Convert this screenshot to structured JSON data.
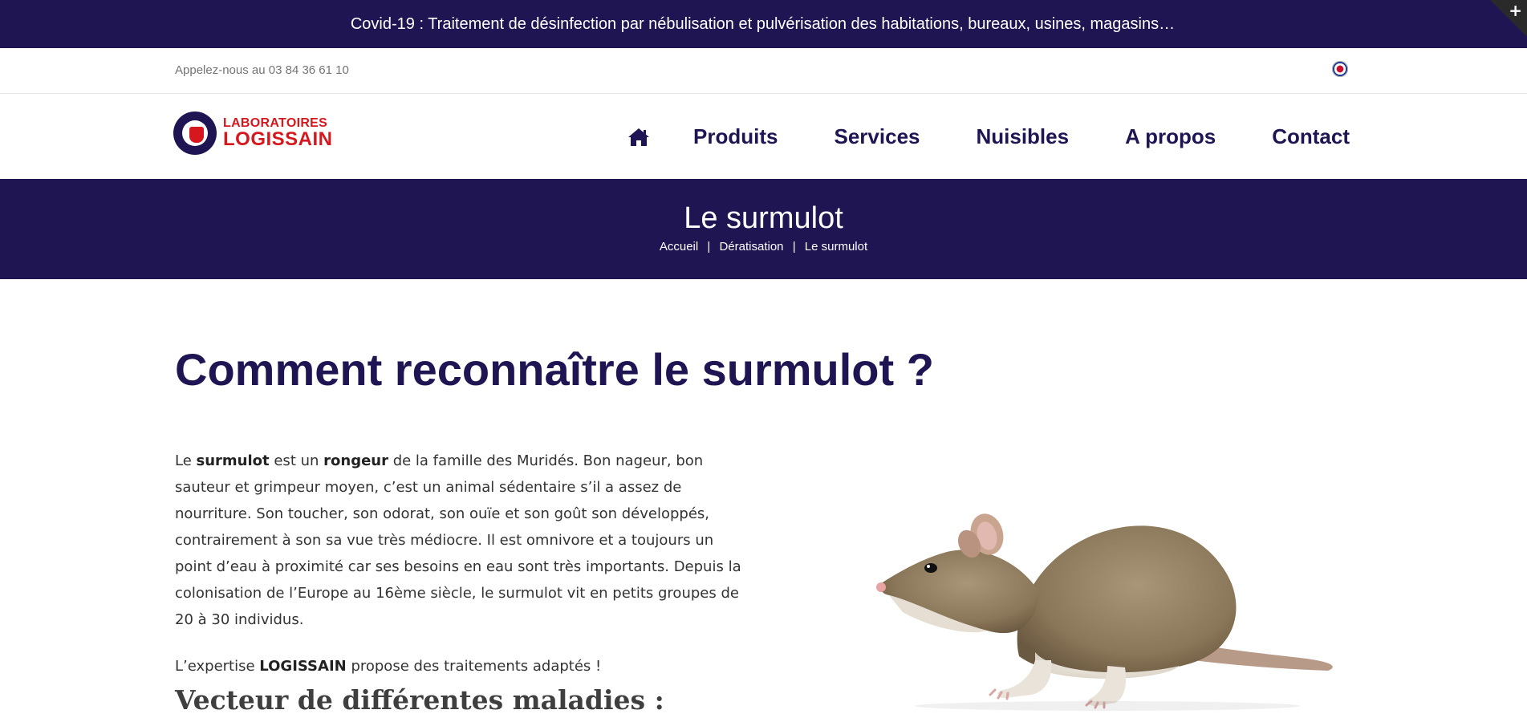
{
  "covid_banner": {
    "text": "Covid-19 : Traitement de désinfection par nébulisation et pulvérisation des habitations, bureaux, usines, magasins…"
  },
  "corner_toggle": {
    "symbol": "+"
  },
  "topbar": {
    "phone_text": "Appelez-nous au 03 84 36 61 10",
    "language_flag_icon": "flag-icon"
  },
  "logo": {
    "line1": "LABORATOIRES",
    "line2": "LOGISSAIN"
  },
  "nav": {
    "home_icon": "home-icon",
    "items": [
      "Produits",
      "Services",
      "Nuisibles",
      "A propos",
      "Contact"
    ]
  },
  "title_band": {
    "title": "Le surmulot",
    "breadcrumb": [
      "Accueil",
      "Dératisation",
      "Le surmulot"
    ],
    "separator": "|"
  },
  "content": {
    "heading": "Comment reconnaître le surmulot ?",
    "paragraph1": {
      "p1": "Le ",
      "b1": "surmulot",
      "p2": " est un ",
      "b2": "rongeur",
      "p3": " de la famille des Muridés. Bon nageur, bon sauteur et grimpeur moyen, c’est un animal sédentaire s’il a assez de nourriture. Son toucher, son odorat, son ouïe et son goût son développés, contrairement à son sa vue très médiocre. Il est omnivore et a toujours un point d’eau à proximité car ses besoins en eau sont très importants. Depuis la colonisation de l’Europe au 16ème siècle, le surmulot vit en petits groupes de 20 à 30 individus."
    },
    "paragraph2": {
      "p1": "L’expertise ",
      "b1": "LOGISSAIN",
      "p2": " propose des traitements adaptés !"
    },
    "subheading": "Vecteur de différentes maladies :"
  },
  "colors": {
    "brand_navy": "#1f1553",
    "brand_red": "#d7171e"
  }
}
